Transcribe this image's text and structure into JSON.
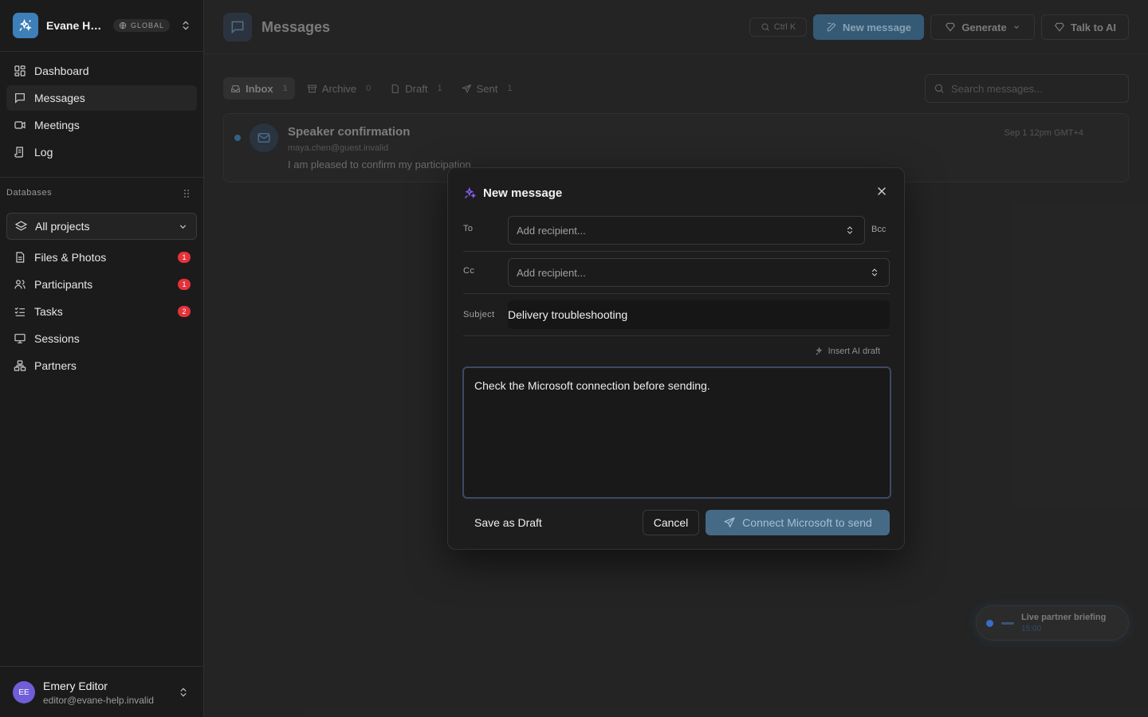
{
  "workspace": {
    "name": "Evane Help Desk",
    "badge": "GLOBAL"
  },
  "nav": [
    {
      "label": "Dashboard",
      "icon": "dashboard-icon"
    },
    {
      "label": "Messages",
      "icon": "message-icon",
      "active": true
    },
    {
      "label": "Meetings",
      "icon": "video-icon"
    },
    {
      "label": "Log",
      "icon": "log-icon"
    }
  ],
  "databases": {
    "label": "Databases",
    "selector": "All projects",
    "items": [
      {
        "label": "Files & Photos",
        "count": "1",
        "icon": "file-icon"
      },
      {
        "label": "Participants",
        "count": "1",
        "icon": "users-icon"
      },
      {
        "label": "Tasks",
        "count": "2",
        "icon": "tasks-icon"
      },
      {
        "label": "Sessions",
        "icon": "presentation-icon"
      },
      {
        "label": "Partners",
        "icon": "network-icon"
      }
    ]
  },
  "user": {
    "initials": "EE",
    "name": "Emery Editor",
    "email": "editor@evane-help.invalid"
  },
  "header": {
    "title": "Messages",
    "shortcut": "Ctrl K",
    "new_message": "New message",
    "generate": "Generate",
    "talk_ai": "Talk to AI"
  },
  "tabs": [
    {
      "label": "Inbox",
      "count": "1"
    },
    {
      "label": "Archive",
      "count": "0"
    },
    {
      "label": "Draft",
      "count": "1"
    },
    {
      "label": "Sent",
      "count": "1"
    }
  ],
  "search": {
    "placeholder": "Search messages..."
  },
  "message": {
    "subject": "Speaker confirmation",
    "from": "maya.chen@guest.invalid",
    "preview": "I am pleased to confirm my participation",
    "date": "Sep 1 12pm GMT+4"
  },
  "live": {
    "title": "Live partner briefing",
    "time": "15:00"
  },
  "modal": {
    "title": "New message",
    "to_label": "To",
    "to_placeholder": "Add recipient...",
    "bcc_label": "Bcc",
    "cc_label": "Cc",
    "cc_placeholder": "Add recipient...",
    "subject_label": "Subject",
    "subject_value": "Delivery troubleshooting",
    "ai_draft": "Insert AI draft",
    "body": "Check the Microsoft connection before sending.",
    "save_draft": "Save as Draft",
    "cancel": "Cancel",
    "send": "Connect Microsoft to send"
  },
  "colors": {
    "accent": "#3d7fb8",
    "badge": "#e5323a",
    "ai": "#8b5cf6"
  }
}
